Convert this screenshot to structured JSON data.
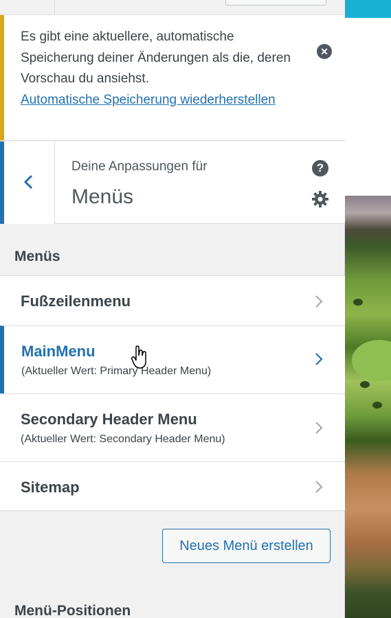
{
  "notice": {
    "message": "Es gibt eine aktuellere, automatische Speicherung deiner Änderungen als die, deren Vorschau du ansiehst.",
    "restore_link": "Automatische Speicherung wiederherstellen",
    "dismiss_icon": "dismiss-circle-icon",
    "accent_color": "#dba617"
  },
  "header": {
    "subtitle": "Deine Anpassungen für",
    "title": "Menüs",
    "back_icon": "chevron-left-icon",
    "help_icon": "help-icon",
    "settings_icon": "gear-icon"
  },
  "menus_section": {
    "heading": "Menüs",
    "items": [
      {
        "label": "Fußzeilenmenu",
        "note": ""
      },
      {
        "label": "MainMenu",
        "note": "(Aktueller Wert: Primary Header Menu)",
        "active": true
      },
      {
        "label": "Secondary Header Menu",
        "note": "(Aktueller Wert: Secondary Header Menu)"
      },
      {
        "label": "Sitemap",
        "note": ""
      }
    ]
  },
  "new_menu_button": "Neues Menü erstellen",
  "positions_section": {
    "heading": "Menü-Positionen"
  },
  "colors": {
    "accent": "#2271b1",
    "text": "#3c434a",
    "panel_bg": "#f1f1f1"
  }
}
